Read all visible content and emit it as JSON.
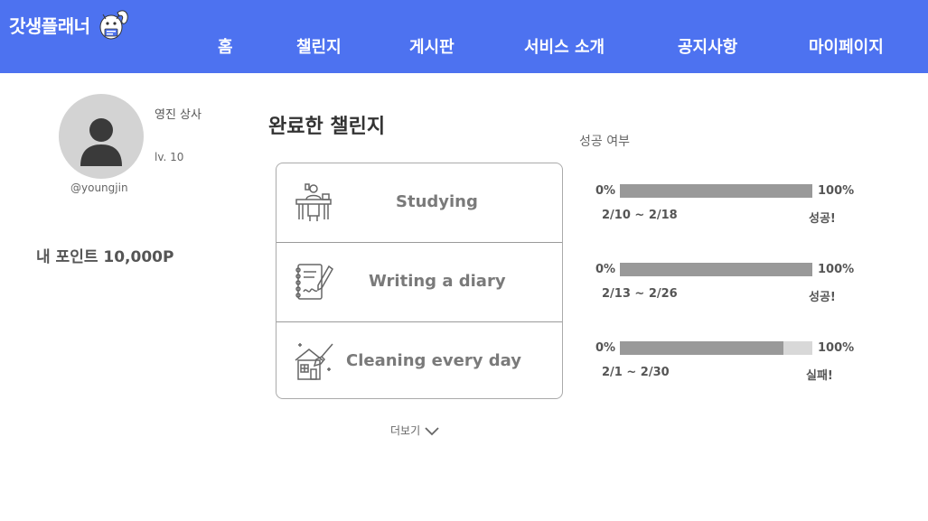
{
  "header": {
    "logo_text": "갓생플래너",
    "brand_color": "#4d72f0",
    "nav": [
      "홈",
      "챌린지",
      "게시판",
      "서비스 소개",
      "공지사항",
      "마이페이지"
    ]
  },
  "profile": {
    "name": "영진 상사",
    "level": "lv. 10",
    "handle": "@youngjin",
    "points": "내 포인트 10,000P"
  },
  "main": {
    "title": "완료한 챌린지",
    "success_header": "성공 여부",
    "more_label": "더보기",
    "challenges": [
      {
        "label": "Studying",
        "icon": "studying-icon",
        "progress_left": "0%",
        "progress_right": "100%",
        "progress": 1.0,
        "dates": "2/10 ~ 2/18",
        "result": "성공!"
      },
      {
        "label": "Writing a diary",
        "icon": "diary-icon",
        "progress_left": "0%",
        "progress_right": "100%",
        "progress": 1.0,
        "dates": "2/13 ~ 2/26",
        "result": "성공!"
      },
      {
        "label": "Cleaning every day",
        "icon": "cleaning-icon",
        "progress_left": "0%",
        "progress_right": "100%",
        "progress": 0.85,
        "dates": "2/1 ~ 2/30",
        "result": "실패!"
      }
    ]
  }
}
